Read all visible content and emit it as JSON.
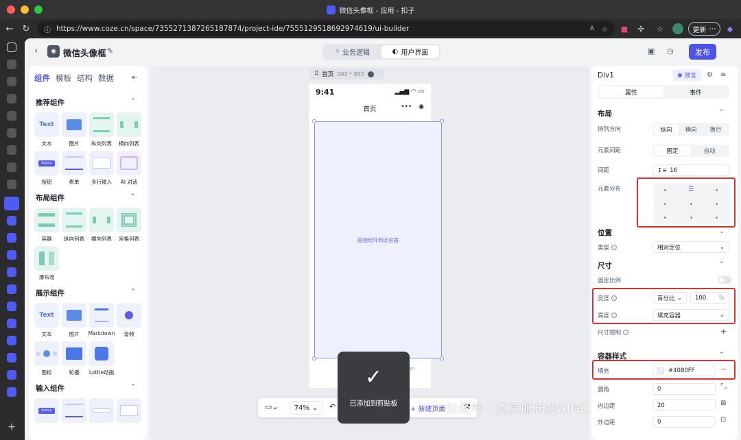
{
  "browser": {
    "tab_title": "微信头像框 - 应用 - 扣子",
    "url": "https://www.coze.cn/space/7355271387265187874/project-ide/7555129518692974619/ui-builder",
    "update_label": "更新"
  },
  "app": {
    "name": "微信头像框",
    "mode_tabs": [
      "业务逻辑",
      "用户界面"
    ],
    "active_mode": "用户界面",
    "publish_label": "发布"
  },
  "left_panel": {
    "tabs": [
      "组件",
      "模板",
      "结构",
      "数据"
    ],
    "sections": [
      {
        "title": "推荐组件",
        "items": [
          "文本",
          "图片",
          "纵向列表",
          "横向列表",
          "按钮",
          "表单",
          "多行输入",
          "AI 对话"
        ]
      },
      {
        "title": "布局组件",
        "items": [
          "容器",
          "纵向列表",
          "横向列表",
          "宫格列表",
          "瀑布流"
        ]
      },
      {
        "title": "展示组件",
        "items": [
          "文本",
          "图片",
          "Markdown",
          "音频",
          "图标",
          "轮播",
          "Lottie动画"
        ]
      },
      {
        "title": "输入组件",
        "items": []
      }
    ],
    "thumb_text": "Text",
    "thumb_button": "Button"
  },
  "canvas": {
    "page_name": "首页",
    "page_size": "393 * 852",
    "phone_time": "9:41",
    "phone_title": "首页",
    "drop_hint": "拖拽组件到此容器",
    "zoom": "74%",
    "new_page_label": "新建页面",
    "toast_text": "已添加到剪贴板",
    "tabbar_partial": "tton"
  },
  "right_panel": {
    "element_name": "Div1",
    "preview_label": "预览",
    "tabs": [
      "属性",
      "事件"
    ],
    "layout": {
      "title": "布局",
      "direction_label": "排列方向",
      "direction_options": [
        "纵向",
        "横向",
        "换行"
      ],
      "spacing_label": "元素间距",
      "spacing_options": [
        "固定",
        "自动"
      ],
      "gap_label": "间距",
      "gap_value": "16",
      "distribution_label": "元素分布"
    },
    "position": {
      "title": "位置",
      "type_label": "类型",
      "type_value": "相对定位"
    },
    "size": {
      "title": "尺寸",
      "fixed_ratio_label": "固定比例",
      "width_label": "宽度",
      "width_unit": "百分比",
      "width_value": "100",
      "width_suffix": "%",
      "height_label": "高度",
      "height_value": "填充容器",
      "limit_label": "尺寸限制"
    },
    "container_style": {
      "title": "容器样式",
      "fill_label": "填充",
      "fill_value": "#4080FF",
      "radius_label": "圆角",
      "radius_value": "0",
      "padding_label": "内边距",
      "padding_value": "20",
      "margin_label": "外边距",
      "margin_value": "0"
    }
  },
  "watermark": "公众号 · 杰克船长的AIGC",
  "colors": {
    "accent": "#4d53e8",
    "highlight": "#e0302d"
  }
}
